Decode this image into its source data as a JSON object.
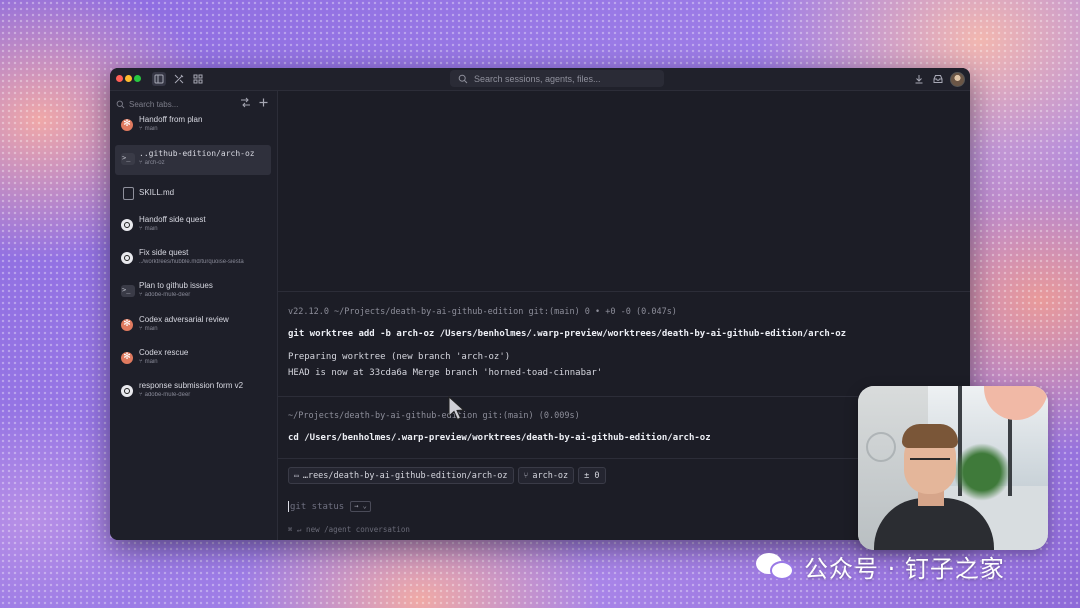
{
  "titlebar": {
    "search_placeholder": "Search sessions, agents, files..."
  },
  "sidebar": {
    "search_placeholder": "Search tabs...",
    "tabs": [
      {
        "title": "Handoff from plan",
        "sub": "main",
        "icon": "claude"
      },
      {
        "title": "..github-edition/arch-oz",
        "sub": "arch-oz",
        "icon": "terminal"
      },
      {
        "title": "SKILL.md",
        "sub": "",
        "icon": "file"
      },
      {
        "title": "Handoff side quest",
        "sub": "main",
        "icon": "openai"
      },
      {
        "title": "Fix side quest",
        "sub": "../worktrees/hubble.md/turquoise-siesta",
        "icon": "openai"
      },
      {
        "title": "Plan to github issues",
        "sub": "adobe-mule-deer",
        "icon": "terminal"
      },
      {
        "title": "Codex adversarial review",
        "sub": "main",
        "icon": "claude"
      },
      {
        "title": "Codex rescue",
        "sub": "main",
        "icon": "claude"
      },
      {
        "title": "response submission form v2",
        "sub": "adobe-mule-deer",
        "icon": "openai"
      }
    ]
  },
  "terminal": {
    "block1": {
      "meta": "v22.12.0 ~/Projects/death-by-ai-github-edition git:(main) 0 • +0 -0 (0.047s)",
      "command": "git worktree add -b arch-oz /Users/benholmes/.warp-preview/worktrees/death-by-ai-github-edition/arch-oz",
      "output": [
        "Preparing worktree (new branch 'arch-oz')",
        "HEAD is now at 33cda6a Merge branch 'horned-toad-cinnabar'"
      ]
    },
    "block2": {
      "meta": "~/Projects/death-by-ai-github-edition git:(main) (0.009s)",
      "command": "cd /Users/benholmes/.warp-preview/worktrees/death-by-ai-github-edition/arch-oz"
    },
    "chips": {
      "path": "…rees/death-by-ai-github-edition/arch-oz",
      "branch": "arch-oz",
      "diff": "± 0"
    },
    "input_placeholder": "git status",
    "arrow_badge": "→ ⌄",
    "hint": "⌘ ↵ new /agent conversation"
  },
  "watermark": {
    "text": "公众号 · 钉子之家"
  },
  "colors": {
    "window_bg": "#1c1d26",
    "sidebar_bg": "#1e1f29",
    "active_tab_bg": "#2f303c",
    "claude_orange": "#e07a5f",
    "background_purple": "#9a7ae6",
    "background_pink": "#f0a8a8"
  }
}
